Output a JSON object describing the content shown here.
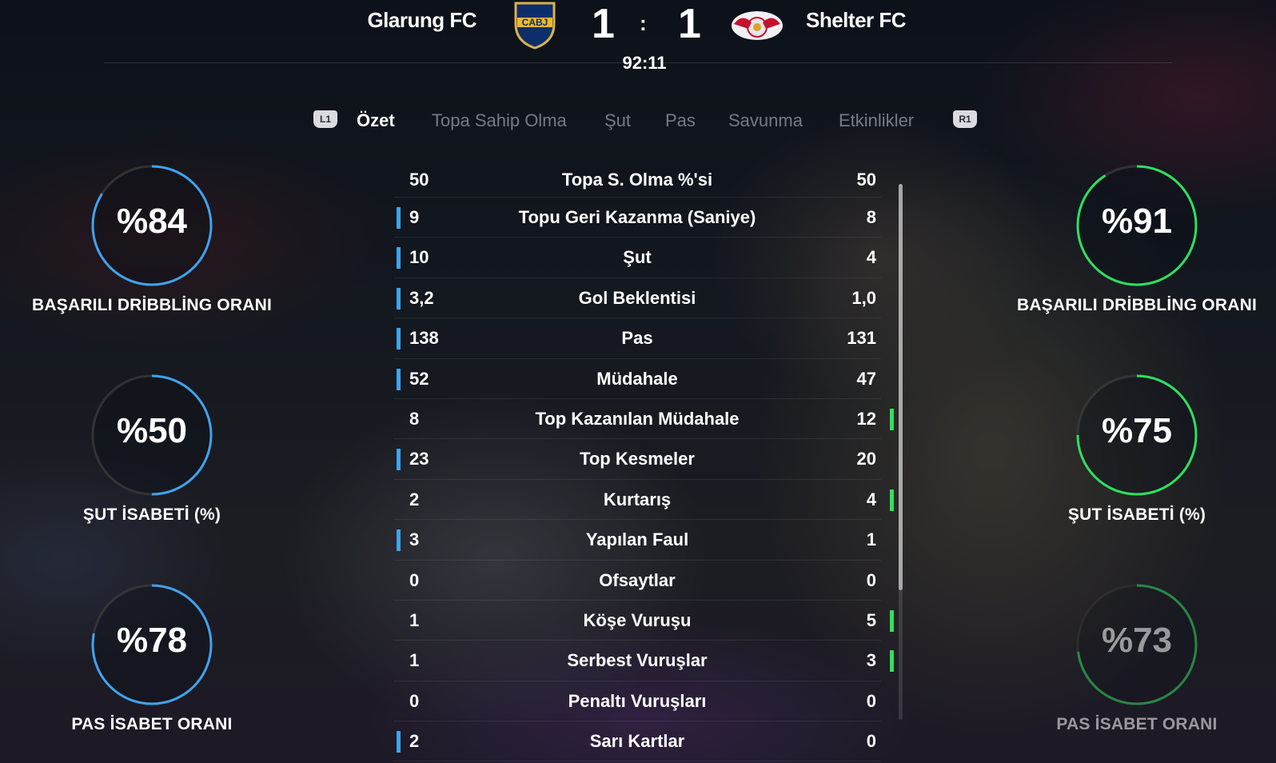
{
  "header": {
    "home_team": "Glarung FC",
    "away_team": "Shelter FC",
    "home_crest_text": "CABJ",
    "home_score": "1",
    "away_score": "1",
    "separator": ":",
    "clock": "92:11"
  },
  "tabs": {
    "left_button": "L1",
    "right_button": "R1",
    "items": [
      "Özet",
      "Topa Sahip Olma",
      "Şut",
      "Pas",
      "Savunma",
      "Etkinlikler"
    ],
    "active": "Özet"
  },
  "home_circles": [
    {
      "value": "%84",
      "label": "BAŞARILI DRİBBLİNG ORANI",
      "fraction": 0.84
    },
    {
      "value": "%50",
      "label": "ŞUT İSABETİ (%)",
      "fraction": 0.5
    },
    {
      "value": "%78",
      "label": "PAS İSABET ORANI",
      "fraction": 0.78
    }
  ],
  "away_circles": [
    {
      "value": "%91",
      "label": "BAŞARILI DRİBBLİNG ORANI",
      "fraction": 0.91
    },
    {
      "value": "%75",
      "label": "ŞUT İSABETİ (%)",
      "fraction": 0.75
    },
    {
      "value": "%73",
      "label": "PAS İSABET ORANI",
      "fraction": 0.73
    }
  ],
  "colors": {
    "home_accent": "#3fa3ee",
    "away_accent": "#2ee05f"
  },
  "stats": [
    {
      "home": "50",
      "label": "Topa S. Olma %'si",
      "away": "50",
      "leader": "none"
    },
    {
      "home": "9",
      "label": "Topu Geri Kazanma (Saniye)",
      "away": "8",
      "leader": "home"
    },
    {
      "home": "10",
      "label": "Şut",
      "away": "4",
      "leader": "home"
    },
    {
      "home": "3,2",
      "label": "Gol Beklentisi",
      "away": "1,0",
      "leader": "home"
    },
    {
      "home": "138",
      "label": "Pas",
      "away": "131",
      "leader": "home"
    },
    {
      "home": "52",
      "label": "Müdahale",
      "away": "47",
      "leader": "home"
    },
    {
      "home": "8",
      "label": "Top Kazanılan Müdahale",
      "away": "12",
      "leader": "away"
    },
    {
      "home": "23",
      "label": "Top Kesmeler",
      "away": "20",
      "leader": "home"
    },
    {
      "home": "2",
      "label": "Kurtarış",
      "away": "4",
      "leader": "away"
    },
    {
      "home": "3",
      "label": "Yapılan Faul",
      "away": "1",
      "leader": "home"
    },
    {
      "home": "0",
      "label": "Ofsaytlar",
      "away": "0",
      "leader": "none"
    },
    {
      "home": "1",
      "label": "Köşe Vuruşu",
      "away": "5",
      "leader": "away"
    },
    {
      "home": "1",
      "label": "Serbest Vuruşlar",
      "away": "3",
      "leader": "away"
    },
    {
      "home": "0",
      "label": "Penaltı Vuruşları",
      "away": "0",
      "leader": "none"
    },
    {
      "home": "2",
      "label": "Sarı Kartlar",
      "away": "0",
      "leader": "home"
    }
  ]
}
